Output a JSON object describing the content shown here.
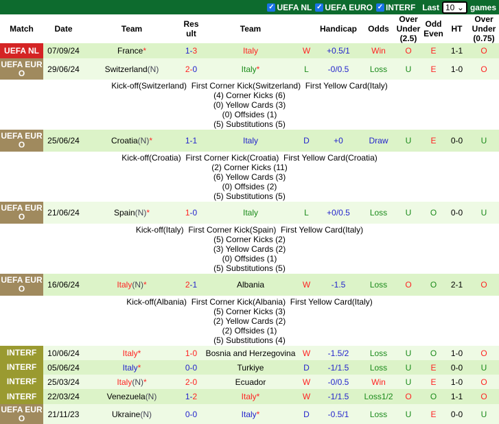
{
  "filters": {
    "items": [
      {
        "label": "UEFA NL",
        "checked": true
      },
      {
        "label": "UEFA EURO",
        "checked": true
      },
      {
        "label": "INTERF",
        "checked": true
      }
    ],
    "last_label": "Last",
    "last_value": "10",
    "games_label": "games"
  },
  "colors": {
    "header_bar": "#0d6b2e",
    "uefa_nl": "#d42424",
    "uefa_euro": "#a08a5e",
    "interf": "#9a9a30",
    "win": "#ff2222",
    "draw": "#2222cc",
    "loss": "#1a8a1a"
  },
  "headers": [
    "Match",
    "Date",
    "Team",
    "Result",
    "Team",
    "",
    "Handicap",
    "Odds",
    "Over Under (2.5)",
    "Odd Even",
    "HT",
    "Over Under (0.75)"
  ],
  "matches": [
    {
      "league": "UEFA NL",
      "lc": "#d42424",
      "date": "07/09/24",
      "home": "France",
      "hc": "black",
      "hs": "*",
      "hn": "",
      "score_h": "1-",
      "sh": "blue",
      "score_a": "3",
      "sa": "red",
      "away": "Italy",
      "ac": "red",
      "as": "",
      "an": "",
      "wl": "W",
      "wlc": "red",
      "hcp": "+0.5/1",
      "odds": "Win",
      "oc": "red",
      "ou": "O",
      "ouc": "red",
      "oe": "E",
      "oec": "red",
      "ht": "1-1",
      "ou2": "O",
      "ou2c": "red",
      "h": 22
    },
    {
      "league": "UEFA EURO",
      "lc": "#a08a5e",
      "date": "29/06/24",
      "home": "Switzerland",
      "hn": "(N)",
      "hc": "black",
      "hs": "",
      "score_h": "2-",
      "sh": "red",
      "score_a": "0",
      "sa": "blue",
      "away": "Italy",
      "ac": "green",
      "as": "*",
      "an": "",
      "wl": "L",
      "wlc": "green",
      "hcp": "-0/0.5",
      "odds": "Loss",
      "oc": "green",
      "ou": "U",
      "ouc": "green",
      "oe": "E",
      "oec": "red",
      "ht": "1-0",
      "ou2": "O",
      "ou2c": "red",
      "h": 31,
      "details": [
        "Kick-off(Switzerland)  First Corner Kick(Switzerland)  First Yellow Card(Italy)",
        "(4) Corner Kicks (6)",
        "(0) Yellow Cards (3)",
        "(0) Offsides (1)",
        "(5) Substitutions (5)"
      ]
    },
    {
      "league": "UEFA EURO",
      "lc": "#a08a5e",
      "date": "25/06/24",
      "home": "Croatia",
      "hn": "(N)",
      "hc": "black",
      "hs": "*",
      "score_h": "1-",
      "sh": "blue",
      "score_a": "1",
      "sa": "blue",
      "away": "Italy",
      "ac": "blue",
      "as": "",
      "an": "",
      "wl": "D",
      "wlc": "blue",
      "hcp": "+0",
      "odds": "Draw",
      "oc": "blue",
      "ou": "U",
      "ouc": "green",
      "oe": "E",
      "oec": "red",
      "ht": "0-0",
      "ou2": "U",
      "ou2c": "green",
      "h": 32,
      "details": [
        "Kick-off(Croatia)  First Corner Kick(Croatia)  First Yellow Card(Croatia)",
        "(2) Corner Kicks (11)",
        "(6) Yellow Cards (3)",
        "(0) Offsides (2)",
        "(5) Substitutions (5)"
      ]
    },
    {
      "league": "UEFA EURO",
      "lc": "#a08a5e",
      "date": "21/06/24",
      "home": "Spain",
      "hn": "(N)",
      "hc": "black",
      "hs": "*",
      "score_h": "1",
      "sh": "red",
      "score_a": "-0",
      "sa": "blue",
      "away": "Italy",
      "ac": "green",
      "as": "",
      "an": "",
      "wl": "L",
      "wlc": "green",
      "hcp": "+0/0.5",
      "odds": "Loss",
      "oc": "green",
      "ou": "U",
      "ouc": "green",
      "oe": "O",
      "oec": "green",
      "ht": "0-0",
      "ou2": "U",
      "ou2c": "green",
      "h": 32,
      "details": [
        "Kick-off(Italy)  First Corner Kick(Spain)  First Yellow Card(Italy)",
        "(5) Corner Kicks (2)",
        "(3) Yellow Cards (2)",
        "(0) Offsides (1)",
        "(5) Substitutions (5)"
      ]
    },
    {
      "league": "UEFA EURO",
      "lc": "#a08a5e",
      "date": "16/06/24",
      "home": "Italy",
      "hn": "(N)",
      "hc": "red",
      "hs": "*",
      "score_h": "2",
      "sh": "red",
      "score_a": "-1",
      "sa": "blue",
      "away": "Albania",
      "ac": "black",
      "as": "",
      "an": "",
      "wl": "W",
      "wlc": "red",
      "hcp": "-1.5",
      "odds": "Loss",
      "oc": "green",
      "ou": "O",
      "ouc": "red",
      "oe": "O",
      "oec": "green",
      "ht": "2-1",
      "ou2": "O",
      "ou2c": "red",
      "h": 32,
      "details": [
        "Kick-off(Albania)  First Corner Kick(Albania)  First Yellow Card(Italy)",
        "(5) Corner Kicks (3)",
        "(2) Yellow Cards (2)",
        "(2) Offsides (1)",
        "(5) Substitutions (4)"
      ]
    },
    {
      "league": "INTERF",
      "lc": "#9a9a30",
      "date": "10/06/24",
      "home": "Italy",
      "hn": "",
      "hc": "red",
      "hs": "*",
      "score_h": "1-",
      "sh": "red",
      "score_a": "0",
      "sa": "red",
      "away": "Bosnia and Herzegovina",
      "ac": "black",
      "as": "",
      "an": "",
      "wl": "W",
      "wlc": "red",
      "hcp": "-1.5/2",
      "odds": "Loss",
      "oc": "green",
      "ou": "U",
      "ouc": "green",
      "oe": "O",
      "oec": "green",
      "ht": "1-0",
      "ou2": "O",
      "ou2c": "red",
      "h": 21
    },
    {
      "league": "INTERF",
      "lc": "#9a9a30",
      "date": "05/06/24",
      "home": "Italy",
      "hn": "",
      "hc": "blue",
      "hs": "*",
      "score_h": "0-",
      "sh": "blue",
      "score_a": "0",
      "sa": "blue",
      "away": "Turkiye",
      "ac": "black",
      "as": "",
      "an": "",
      "wl": "D",
      "wlc": "blue",
      "hcp": "-1/1.5",
      "odds": "Loss",
      "oc": "green",
      "ou": "U",
      "ouc": "green",
      "oe": "E",
      "oec": "red",
      "ht": "0-0",
      "ou2": "U",
      "ou2c": "green",
      "h": 21
    },
    {
      "league": "INTERF",
      "lc": "#9a9a30",
      "date": "25/03/24",
      "home": "Italy",
      "hn": "(N)",
      "hc": "red",
      "hs": "*",
      "score_h": "2-",
      "sh": "red",
      "score_a": "0",
      "sa": "red",
      "away": "Ecuador",
      "ac": "black",
      "as": "",
      "an": "",
      "wl": "W",
      "wlc": "red",
      "hcp": "-0/0.5",
      "odds": "Win",
      "oc": "red",
      "ou": "U",
      "ouc": "green",
      "oe": "E",
      "oec": "red",
      "ht": "1-0",
      "ou2": "O",
      "ou2c": "red",
      "h": 21
    },
    {
      "league": "INTERF",
      "lc": "#9a9a30",
      "date": "22/03/24",
      "home": "Venezuela",
      "hn": "(N)",
      "hc": "black",
      "hs": "",
      "score_h": "1-",
      "sh": "blue",
      "score_a": "2",
      "sa": "red",
      "away": "Italy",
      "ac": "red",
      "as": "*",
      "an": "",
      "wl": "W",
      "wlc": "red",
      "hcp": "-1/1.5",
      "odds": "Loss1/2",
      "oc": "green",
      "ou": "O",
      "ouc": "red",
      "oe": "O",
      "oec": "green",
      "ht": "1-1",
      "ou2": "O",
      "ou2c": "red",
      "h": 22
    },
    {
      "league": "UEFA EURO",
      "lc": "#a08a5e",
      "date": "21/11/23",
      "home": "Ukraine",
      "hn": "(N)",
      "hc": "black",
      "hs": "",
      "score_h": "0-",
      "sh": "blue",
      "score_a": "0",
      "sa": "blue",
      "away": "Italy",
      "ac": "blue",
      "as": "*",
      "an": "",
      "wl": "D",
      "wlc": "blue",
      "hcp": "-0.5/1",
      "odds": "Loss",
      "oc": "green",
      "ou": "U",
      "ouc": "green",
      "oe": "E",
      "oec": "red",
      "ht": "0-0",
      "ou2": "U",
      "ou2c": "green",
      "h": 29
    }
  ]
}
